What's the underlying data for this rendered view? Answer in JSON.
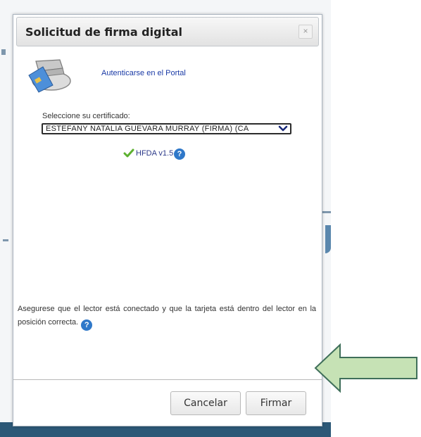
{
  "dialog": {
    "title": "Solicitud de firma digital",
    "close_label": "×",
    "auth_link": "Autenticarse en el Portal",
    "certificate": {
      "label": "Seleccione su certificado:",
      "selected": "ESTEFANY NATALIA GUEVARA MURRAY (FIRMA) (CA"
    },
    "hfda_version": "HFDA v1.5",
    "help_glyph": "?",
    "instruction": "Asegurese que el lector está conectado y que la tarjeta está dentro del lector en la posición correcta.",
    "buttons": {
      "cancel": "Cancelar",
      "sign": "Firmar"
    }
  },
  "icons": {
    "card_reader": "card-reader-icon",
    "check": "check-icon",
    "help": "help-icon",
    "close": "close-icon",
    "chevron": "chevron-down-icon"
  },
  "colors": {
    "link": "#1a3aa6",
    "help": "#2f78c9",
    "check": "#5db130",
    "arrow_fill": "#c6e2b5",
    "arrow_stroke": "#3f6f5a",
    "background_bar": "#2c5877"
  }
}
